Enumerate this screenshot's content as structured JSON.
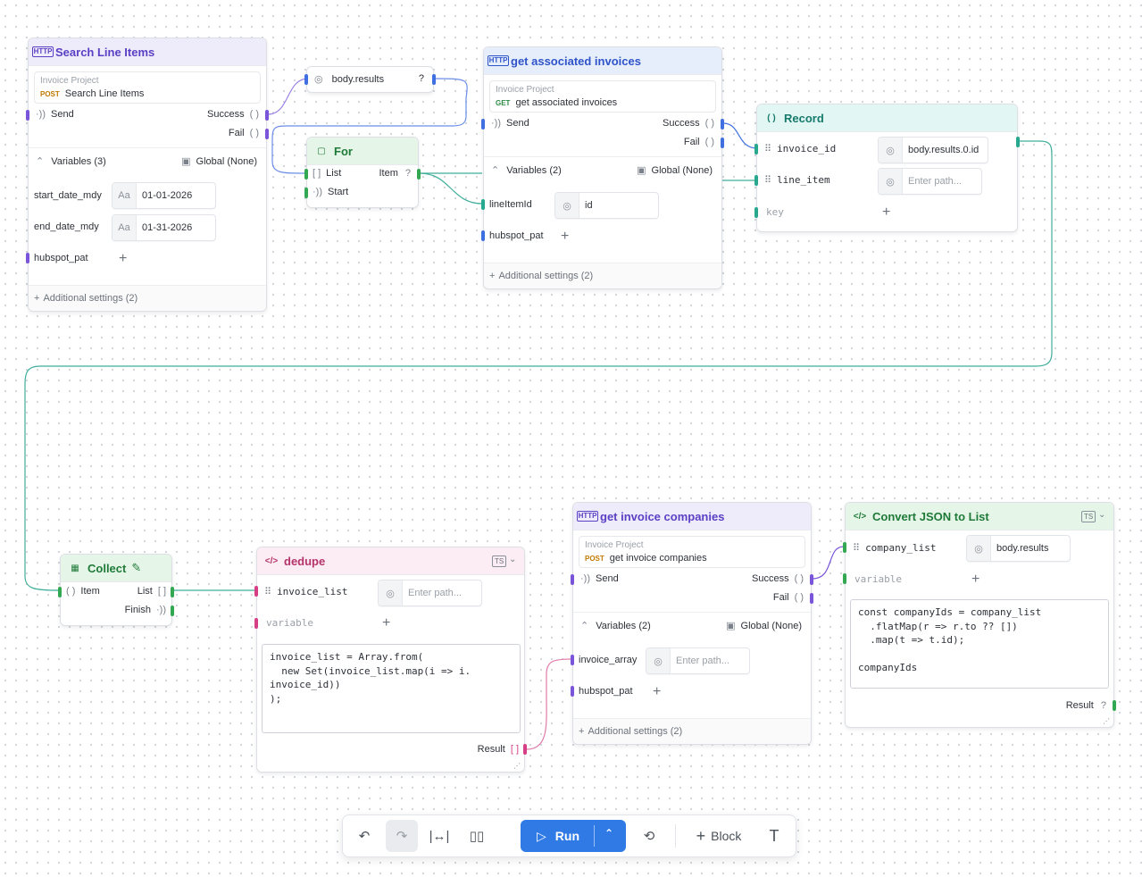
{
  "nodes": {
    "search_line_items": {
      "title": "Search Line Items",
      "project": "Invoice Project",
      "method": "POST",
      "endpoint": "Search Line Items",
      "send": "Send",
      "success": "Success",
      "fail": "Fail",
      "variables_header": "Variables (3)",
      "global": "Global (None)",
      "variables": [
        {
          "name": "start_date_mdy",
          "type_icon": "Aa",
          "value": "01-01-2026"
        },
        {
          "name": "end_date_mdy",
          "type_icon": "Aa",
          "value": "01-31-2026"
        },
        {
          "name": "hubspot_pat"
        }
      ],
      "additional": "Additional settings (2)"
    },
    "body_results": {
      "label": "body.results",
      "q": "?"
    },
    "for": {
      "title": "For",
      "list": "List",
      "item": "Item",
      "q": "?",
      "start": "Start"
    },
    "get_associated_invoices": {
      "title": "get associated invoices",
      "project": "Invoice Project",
      "method": "GET",
      "endpoint": "get associated invoices",
      "send": "Send",
      "success": "Success",
      "fail": "Fail",
      "variables_header": "Variables (2)",
      "global": "Global (None)",
      "variables": [
        {
          "name": "lineItemId",
          "value": "id"
        },
        {
          "name": "hubspot_pat"
        }
      ],
      "additional": "Additional settings (2)"
    },
    "record": {
      "title": "Record",
      "fields": [
        {
          "name": "invoice_id",
          "value": "body.results.0.id"
        },
        {
          "name": "line_item",
          "placeholder": "Enter path..."
        }
      ],
      "key_placeholder": "key"
    },
    "collect": {
      "title": "Collect",
      "item": "Item",
      "list": "List",
      "finish": "Finish"
    },
    "dedupe": {
      "title": "dedupe",
      "field": "invoice_list",
      "placeholder": "Enter path...",
      "variable_placeholder": "variable",
      "code": [
        "invoice_list = Array.from(",
        "  new Set(invoice_list.map(i => i.",
        "invoice_id))",
        ");"
      ],
      "result": "Result"
    },
    "get_invoice_companies": {
      "title": "get invoice companies",
      "project": "Invoice Project",
      "method": "POST",
      "endpoint": "get invoice companies",
      "send": "Send",
      "success": "Success",
      "fail": "Fail",
      "variables_header": "Variables (2)",
      "global": "Global (None)",
      "variables": [
        {
          "name": "invoice_array",
          "placeholder": "Enter path..."
        },
        {
          "name": "hubspot_pat"
        }
      ],
      "additional": "Additional settings (2)"
    },
    "convert_json": {
      "title": "Convert JSON to List",
      "field": "company_list",
      "value": "body.results",
      "variable_placeholder": "variable",
      "code": [
        "const companyIds = company_list",
        "  .flatMap(r => r.to ?? [])",
        "  .map(t => t.id);",
        "",
        "companyIds"
      ],
      "result": "Result",
      "q": "?"
    }
  },
  "toolbar": {
    "run": "Run",
    "block": "Block",
    "text_tool": "T"
  },
  "colors": {
    "run_button": "#2f7ae5",
    "wire_purple": "#7a55d9",
    "wire_blue": "#3f6fe0",
    "wire_teal": "#28a88f",
    "wire_green": "#33a853",
    "wire_pink": "#d63f86"
  }
}
